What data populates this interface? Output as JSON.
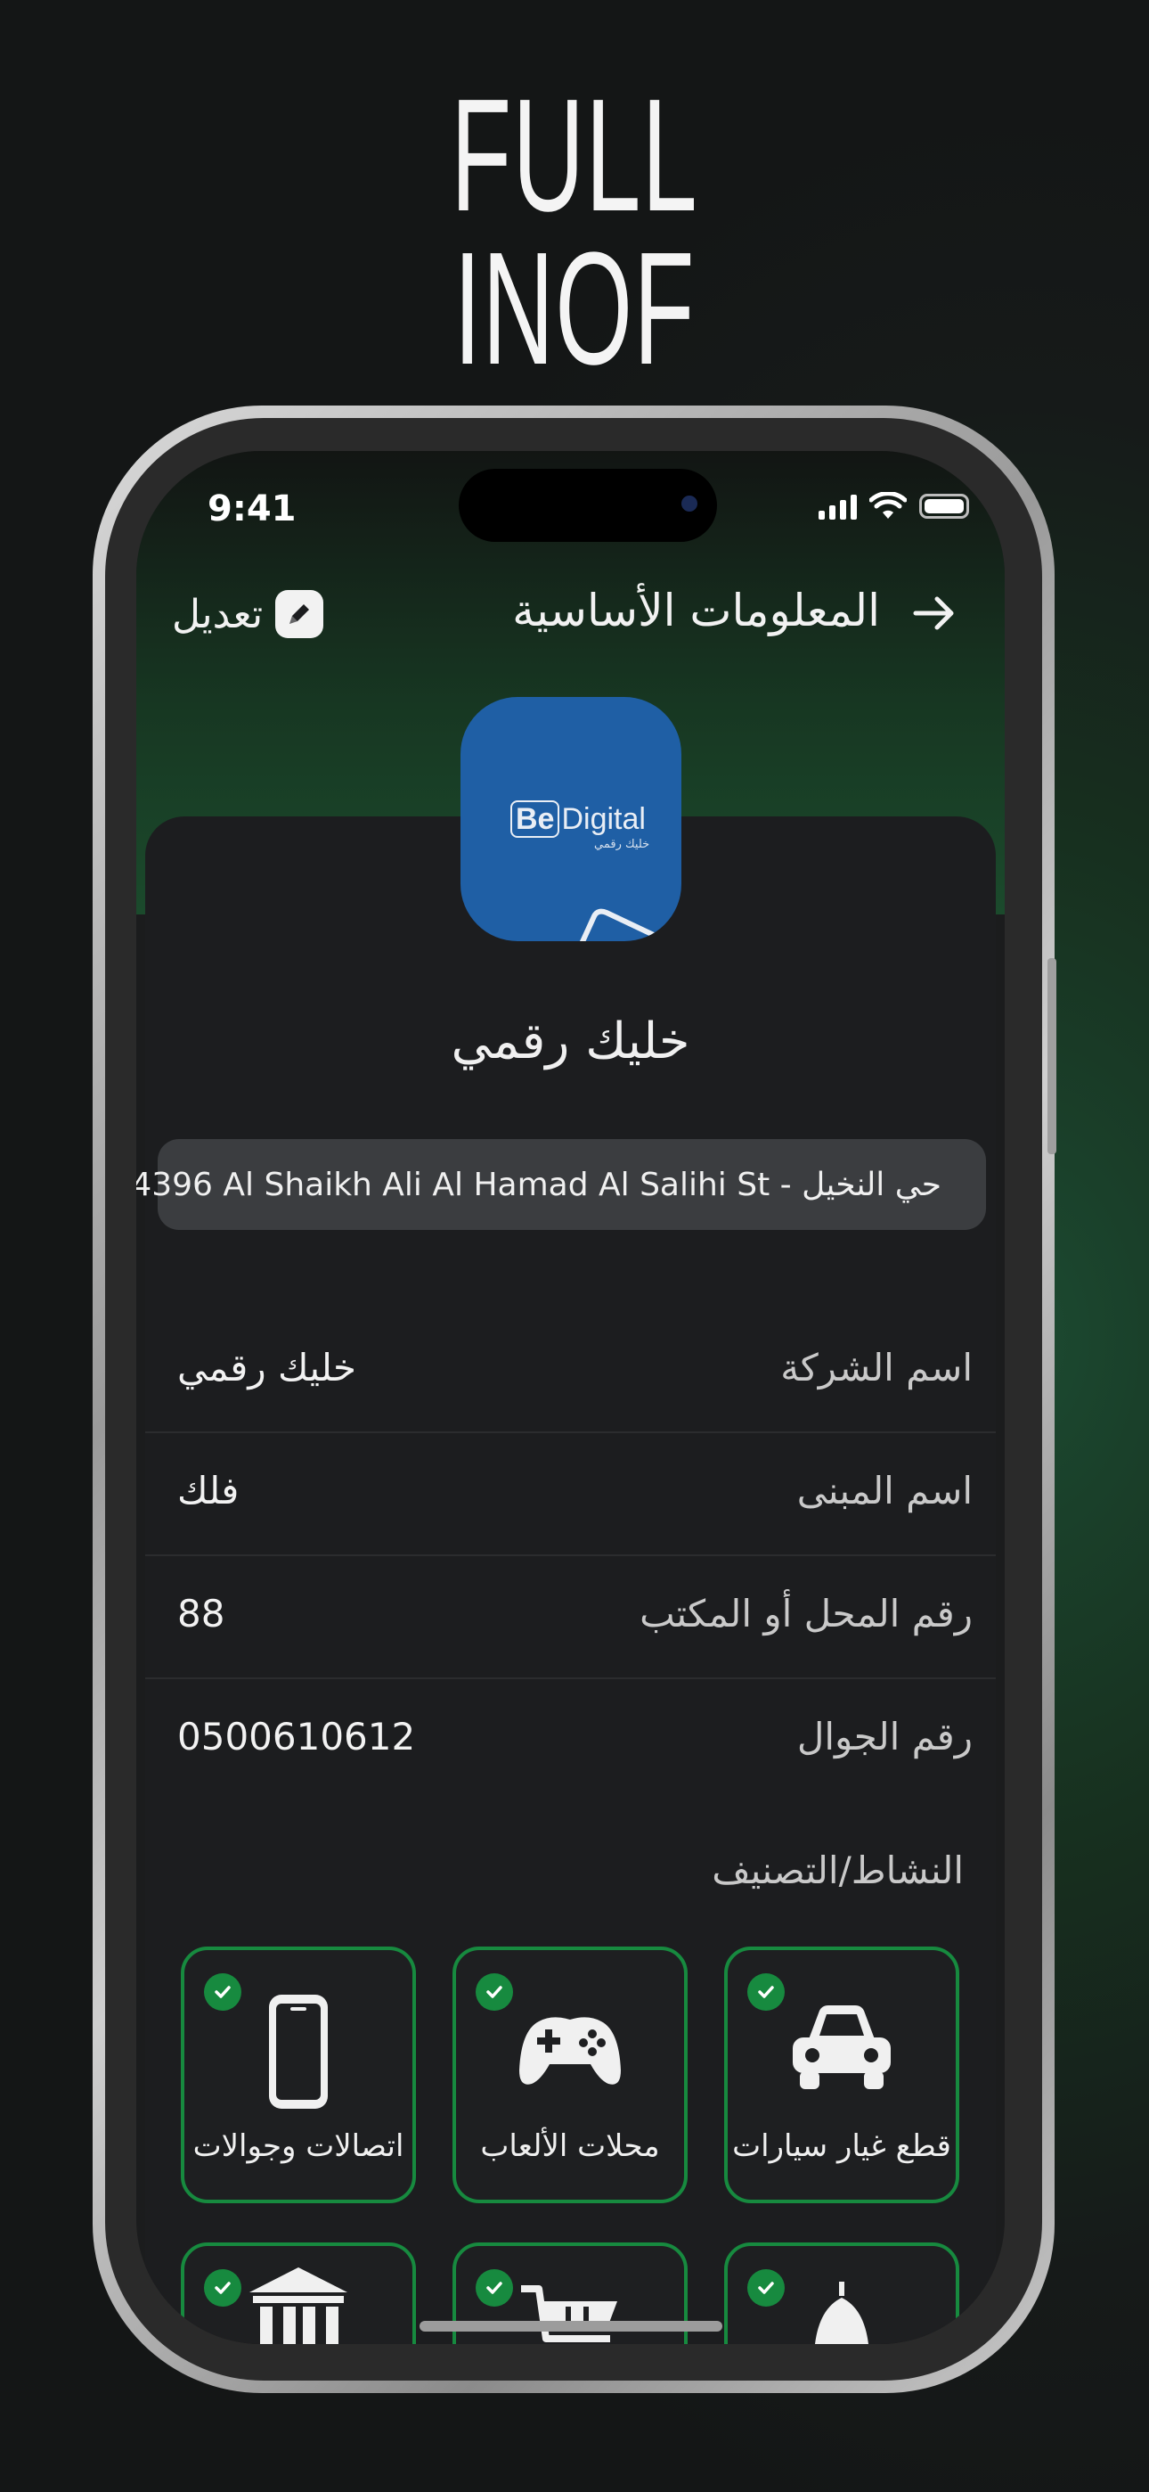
{
  "headline": {
    "line1": "FULL",
    "line2": "INOF"
  },
  "status_bar": {
    "time": "9:41"
  },
  "nav": {
    "title": "المعلومات الأساسية",
    "edit_label": "تعديل"
  },
  "logo": {
    "brand_prefix": "Be",
    "brand_suffix": "Digital",
    "tagline": "خليك رقمي"
  },
  "company": {
    "name": "خليك رقمي"
  },
  "address": {
    "text": "4396 Al Shaikh Ali Al Hamad Al Salihi St - حي النخيل"
  },
  "info_rows": [
    {
      "label": "اسم الشركة",
      "value": "خليك رقمي"
    },
    {
      "label": "اسم المبنى",
      "value": "فلك"
    },
    {
      "label": "رقم المحل أو المكتب",
      "value": "88"
    },
    {
      "label": "رقم الجوال",
      "value": "0500610612"
    }
  ],
  "categories_title": "النشاط/التصنيف",
  "categories": [
    {
      "label": "قطع غيار سيارات",
      "icon": "car-icon",
      "selected": true
    },
    {
      "label": "محلات الألعاب",
      "icon": "gamepad-icon",
      "selected": true
    },
    {
      "label": "اتصالات وجوالات",
      "icon": "smartphone-icon",
      "selected": true
    },
    {
      "label": "",
      "icon": "mosque-icon",
      "selected": true
    },
    {
      "label": "",
      "icon": "cart-icon",
      "selected": true
    },
    {
      "label": "",
      "icon": "bank-icon",
      "selected": true
    }
  ],
  "colors": {
    "accent": "#178a3f",
    "card": "#1c1d1f",
    "pill": "#3b3d40",
    "logo_bg": "#1f5fa5"
  }
}
